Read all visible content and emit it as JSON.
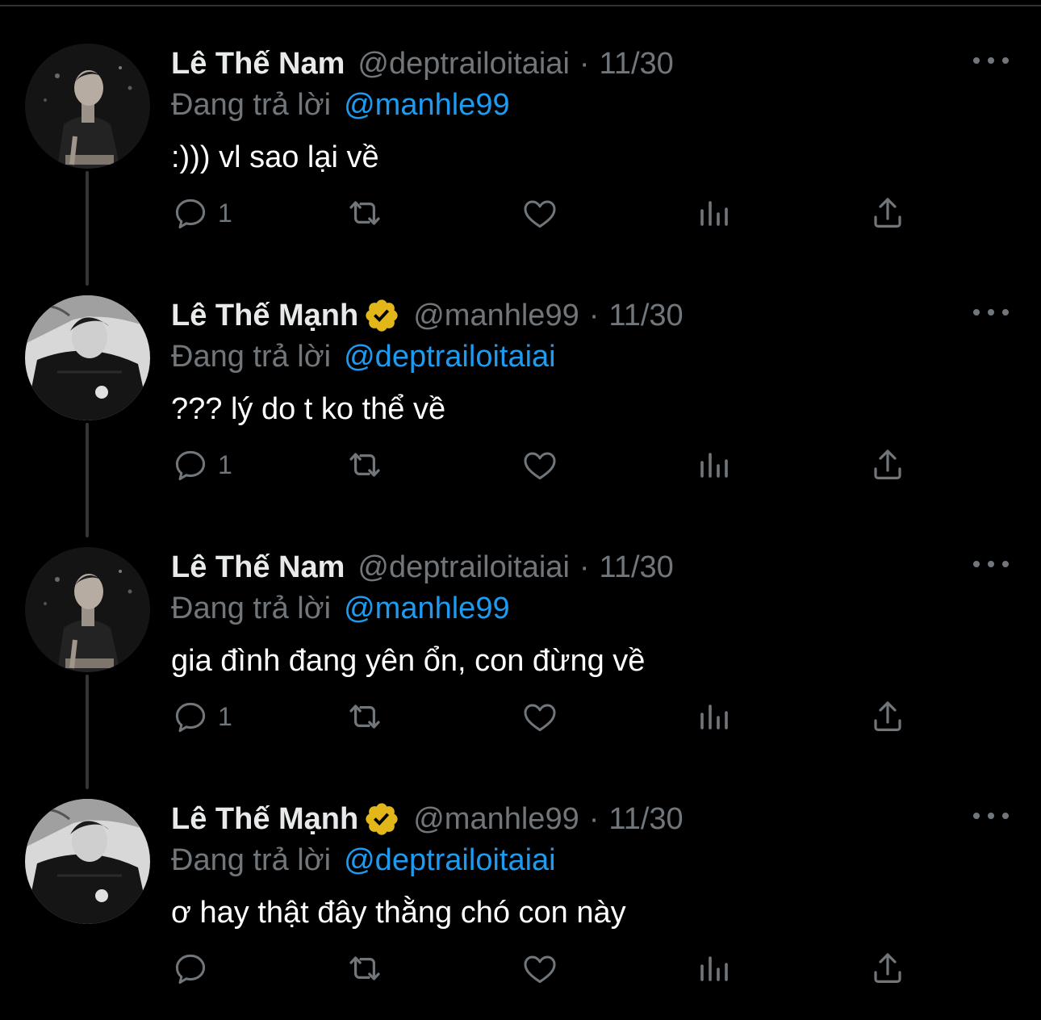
{
  "tweets": [
    {
      "name": "Lê Thế Nam",
      "verified": false,
      "handle": "@deptrailoitaiai",
      "dot": "·",
      "date": "11/30",
      "reply_prefix": "Đang trả lời",
      "reply_to": "@manhle99",
      "text": ":))) vl sao lại về",
      "reply_count": "1"
    },
    {
      "name": "Lê Thế Mạnh",
      "verified": true,
      "handle": "@manhle99",
      "dot": "·",
      "date": "11/30",
      "reply_prefix": "Đang trả lời",
      "reply_to": "@deptrailoitaiai",
      "text": "??? lý do t ko thể về",
      "reply_count": "1"
    },
    {
      "name": "Lê Thế Nam",
      "verified": false,
      "handle": "@deptrailoitaiai",
      "dot": "·",
      "date": "11/30",
      "reply_prefix": "Đang trả lời",
      "reply_to": "@manhle99",
      "text": "gia đình đang yên ổn, con đừng về",
      "reply_count": "1"
    },
    {
      "name": "Lê Thế Mạnh",
      "verified": true,
      "handle": "@manhle99",
      "dot": "·",
      "date": "11/30",
      "reply_prefix": "Đang trả lời",
      "reply_to": "@deptrailoitaiai",
      "text": "ơ hay thật đây thằng chó con này",
      "reply_count": ""
    }
  ],
  "icons": {
    "reply": "reply-icon",
    "retweet": "retweet-icon",
    "like": "heart-icon",
    "views": "views-icon",
    "share": "share-icon",
    "more": "more-icon",
    "verified": "verified-badge-icon"
  },
  "colors": {
    "background": "#000000",
    "text": "#e7e9ea",
    "muted": "#71767b",
    "link": "#1d9bf0",
    "verified_badge": "#e2b719",
    "thread_line": "#333639"
  }
}
